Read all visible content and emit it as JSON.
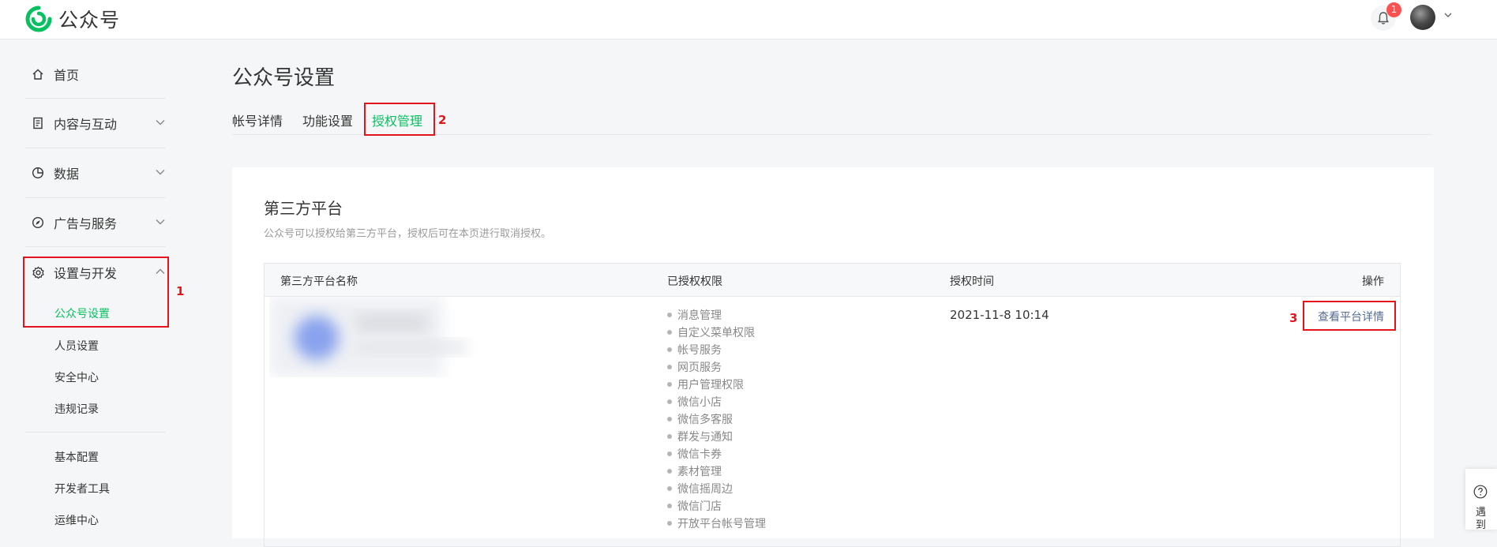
{
  "app": {
    "logo_text": "公众号",
    "notification_count": "1",
    "brand_color": "#07c160",
    "link_color": "#576b95"
  },
  "sidebar": {
    "home": "首页",
    "content": "内容与互动",
    "data": "数据",
    "ads": "广告与服务",
    "settings": "设置与开发",
    "sub_items": [
      "公众号设置",
      "人员设置",
      "安全中心",
      "违规记录"
    ],
    "dev_items": [
      "基本配置",
      "开发者工具",
      "运维中心"
    ]
  },
  "main": {
    "page_title": "公众号设置",
    "tabs": [
      "帐号详情",
      "功能设置",
      "授权管理"
    ],
    "active_tab": "授权管理"
  },
  "section": {
    "title": "第三方平台",
    "description": "公众号可以授权给第三方平台，授权后可在本页进行取消授权。"
  },
  "table": {
    "headers": [
      "第三方平台名称",
      "已授权权限",
      "授权时间",
      "操作"
    ],
    "row": {
      "permissions": [
        "消息管理",
        "自定义菜单权限",
        "帐号服务",
        "网页服务",
        "用户管理权限",
        "微信小店",
        "微信多客服",
        "群发与通知",
        "微信卡券",
        "素材管理",
        "微信摇周边",
        "微信门店",
        "开放平台帐号管理"
      ],
      "auth_time": "2021-11-8 10:14",
      "action": "查看平台详情"
    }
  },
  "annotations": [
    "1",
    "2",
    "3"
  ],
  "float_help": {
    "label": "遇到"
  }
}
